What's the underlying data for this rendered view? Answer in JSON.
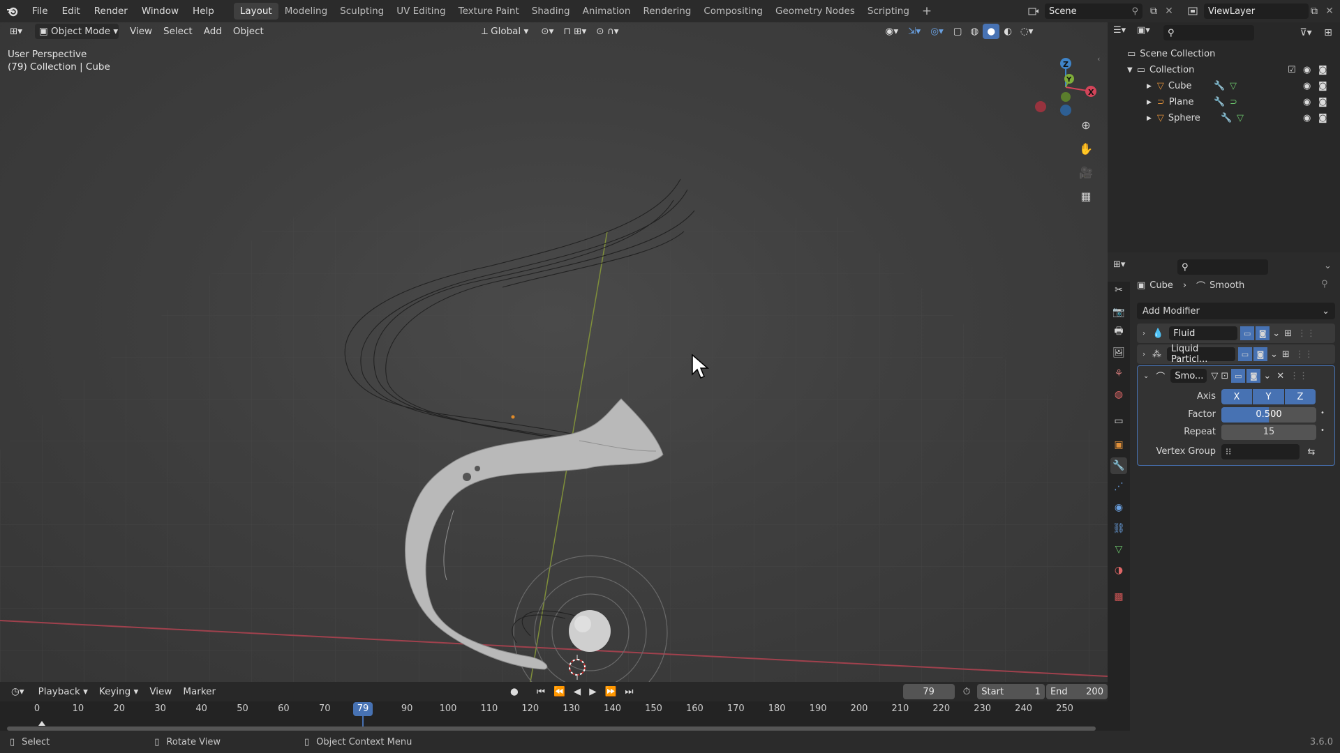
{
  "menubar": {
    "items": [
      "File",
      "Edit",
      "Render",
      "Window",
      "Help"
    ],
    "workspaces": [
      "Layout",
      "Modeling",
      "Sculpting",
      "UV Editing",
      "Texture Paint",
      "Shading",
      "Animation",
      "Rendering",
      "Compositing",
      "Geometry Nodes",
      "Scripting"
    ],
    "active_workspace": "Layout",
    "add_tab": "+",
    "scene": "Scene",
    "view_layer": "ViewLayer"
  },
  "viewport": {
    "mode": "Object Mode",
    "menus": [
      "View",
      "Select",
      "Add",
      "Object"
    ],
    "transform_orientation": "Global",
    "overlay_title": "User Perspective",
    "overlay_subtitle": "(79) Collection | Cube",
    "gizmo": {
      "z": "Z",
      "y": "Y",
      "x": "X"
    }
  },
  "outliner": {
    "scene_collection": "Scene Collection",
    "collection": "Collection",
    "objects": [
      {
        "name": "Cube"
      },
      {
        "name": "Plane"
      },
      {
        "name": "Sphere"
      }
    ]
  },
  "properties": {
    "breadcrumb_object": "Cube",
    "breadcrumb_modifier": "Smooth",
    "add_modifier": "Add Modifier",
    "modifiers": [
      {
        "name": "Fluid",
        "expanded": false
      },
      {
        "name": "Liquid Particl...",
        "expanded": false
      },
      {
        "name": "Smo...",
        "expanded": true
      }
    ],
    "smooth": {
      "axis_label": "Axis",
      "axes": [
        "X",
        "Y",
        "Z"
      ],
      "factor_label": "Factor",
      "factor": "0.500",
      "repeat_label": "Repeat",
      "repeat": "15",
      "vertex_group_label": "Vertex Group"
    }
  },
  "timeline": {
    "menus": [
      "Playback",
      "Keying",
      "View",
      "Marker"
    ],
    "current_frame": "79",
    "start_label": "Start",
    "start": "1",
    "end_label": "End",
    "end": "200",
    "ticks": [
      "0",
      "10",
      "20",
      "30",
      "40",
      "50",
      "60",
      "70",
      "90",
      "100",
      "110",
      "120",
      "130",
      "140",
      "150",
      "160",
      "170",
      "180",
      "190",
      "200",
      "210",
      "220",
      "230",
      "240",
      "250"
    ],
    "playhead": "79"
  },
  "statusbar": {
    "select": "Select",
    "rotate": "Rotate View",
    "context": "Object Context Menu",
    "version": "3.6.0"
  }
}
